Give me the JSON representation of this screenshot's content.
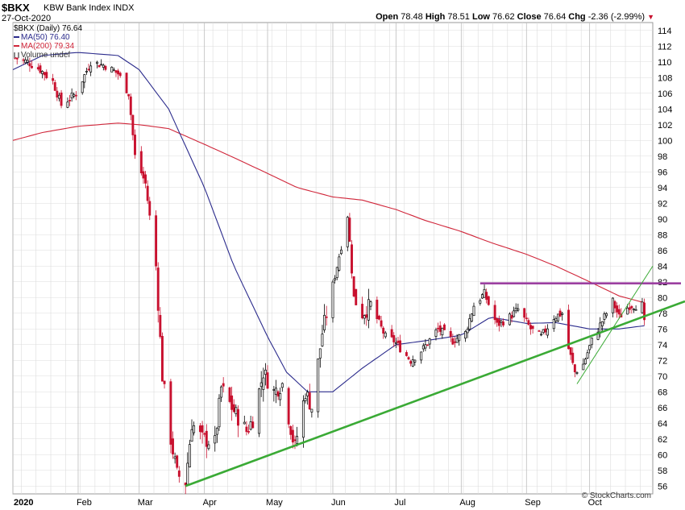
{
  "header": {
    "ticker": "$BKX",
    "name": "KBW Bank Index",
    "exchange": "INDX",
    "date": "27-Oct-2020",
    "open_label": "Open",
    "open": "78.48",
    "high_label": "High",
    "high": "78.51",
    "low_label": "Low",
    "low": "76.62",
    "close_label": "Close",
    "close": "76.64",
    "chg_label": "Chg",
    "chg": "-2.36 (-2.99%)"
  },
  "legend": {
    "price": "$BKX (Daily) 76.64",
    "ma50": "MA(50) 76.40",
    "ma200": "MA(200) 79.34",
    "volume": "Volume undef"
  },
  "credit": "© StockCharts.com",
  "colors": {
    "up": "#000000",
    "down": "#c8102e",
    "ma50": "#2b2b8c",
    "ma200": "#d0263a",
    "trend": "#3aaa35",
    "resistance": "#9b3fa0",
    "grid": "#dcdcdc"
  },
  "chart_data": {
    "type": "candlestick",
    "x_range": [
      "2020-01-01",
      "2020-10-31"
    ],
    "ylim": [
      55,
      115
    ],
    "y_ticks": [
      56,
      58,
      60,
      62,
      64,
      66,
      68,
      70,
      72,
      74,
      76,
      78,
      80,
      82,
      84,
      86,
      88,
      90,
      92,
      94,
      96,
      98,
      100,
      102,
      104,
      106,
      108,
      110,
      112,
      114
    ],
    "x_ticks": [
      {
        "label": "2020",
        "date": "2020-01-01"
      },
      {
        "label": "Feb",
        "date": "2020-02-01"
      },
      {
        "label": "Mar",
        "date": "2020-03-01"
      },
      {
        "label": "Apr",
        "date": "2020-04-01"
      },
      {
        "label": "May",
        "date": "2020-05-01"
      },
      {
        "label": "Jun",
        "date": "2020-06-01"
      },
      {
        "label": "Jul",
        "date": "2020-07-01"
      },
      {
        "label": "Aug",
        "date": "2020-08-01"
      },
      {
        "label": "Sep",
        "date": "2020-09-01"
      },
      {
        "label": "Oct",
        "date": "2020-10-01"
      }
    ],
    "close_waypoints": [
      [
        "2020-01-02",
        110.5
      ],
      [
        "2020-01-08",
        110.0
      ],
      [
        "2020-01-14",
        109.0
      ],
      [
        "2020-01-20",
        107.5
      ],
      [
        "2020-01-24",
        104.5
      ],
      [
        "2020-01-31",
        106.0
      ],
      [
        "2020-02-07",
        110.0
      ],
      [
        "2020-02-14",
        109.5
      ],
      [
        "2020-02-20",
        108.5
      ],
      [
        "2020-02-25",
        106.0
      ],
      [
        "2020-02-28",
        98.0
      ],
      [
        "2020-03-04",
        94.5
      ],
      [
        "2020-03-09",
        84.0
      ],
      [
        "2020-03-12",
        70.0
      ],
      [
        "2020-03-16",
        62.0
      ],
      [
        "2020-03-19",
        57.5
      ],
      [
        "2020-03-23",
        56.5
      ],
      [
        "2020-03-26",
        64.0
      ],
      [
        "2020-03-31",
        62.0
      ],
      [
        "2020-04-06",
        61.5
      ],
      [
        "2020-04-09",
        68.5
      ],
      [
        "2020-04-14",
        66.0
      ],
      [
        "2020-04-21",
        63.0
      ],
      [
        "2020-04-24",
        64.5
      ],
      [
        "2020-04-29",
        70.5
      ],
      [
        "2020-05-04",
        68.0
      ],
      [
        "2020-05-08",
        69.0
      ],
      [
        "2020-05-13",
        62.0
      ],
      [
        "2020-05-14",
        61.0
      ],
      [
        "2020-05-19",
        68.0
      ],
      [
        "2020-05-22",
        66.0
      ],
      [
        "2020-05-27",
        75.5
      ],
      [
        "2020-06-03",
        84.0
      ],
      [
        "2020-06-08",
        90.5
      ],
      [
        "2020-06-11",
        80.0
      ],
      [
        "2020-06-15",
        78.0
      ],
      [
        "2020-06-19",
        79.0
      ],
      [
        "2020-06-26",
        75.0
      ],
      [
        "2020-06-30",
        74.5
      ],
      [
        "2020-07-08",
        72.0
      ],
      [
        "2020-07-14",
        73.5
      ],
      [
        "2020-07-21",
        76.0
      ],
      [
        "2020-07-28",
        74.5
      ],
      [
        "2020-08-03",
        75.5
      ],
      [
        "2020-08-07",
        79.0
      ],
      [
        "2020-08-12",
        80.5
      ],
      [
        "2020-08-18",
        76.5
      ],
      [
        "2020-08-24",
        77.5
      ],
      [
        "2020-08-28",
        78.5
      ],
      [
        "2020-09-03",
        76.0
      ],
      [
        "2020-09-08",
        75.0
      ],
      [
        "2020-09-14",
        77.5
      ],
      [
        "2020-09-18",
        78.0
      ],
      [
        "2020-09-21",
        73.5
      ],
      [
        "2020-09-24",
        70.5
      ],
      [
        "2020-09-28",
        71.5
      ],
      [
        "2020-10-02",
        74.5
      ],
      [
        "2020-10-07",
        77.0
      ],
      [
        "2020-10-12",
        79.5
      ],
      [
        "2020-10-15",
        77.5
      ],
      [
        "2020-10-20",
        79.0
      ],
      [
        "2020-10-23",
        79.0
      ],
      [
        "2020-10-26",
        79.0
      ],
      [
        "2020-10-27",
        76.64
      ]
    ],
    "ma50_waypoints": [
      [
        "2020-01-01",
        109.0
      ],
      [
        "2020-01-15",
        110.8
      ],
      [
        "2020-02-01",
        111.2
      ],
      [
        "2020-02-20",
        110.8
      ],
      [
        "2020-03-01",
        109.0
      ],
      [
        "2020-03-15",
        104.0
      ],
      [
        "2020-04-01",
        94.0
      ],
      [
        "2020-04-15",
        84.0
      ],
      [
        "2020-05-01",
        75.0
      ],
      [
        "2020-05-10",
        70.5
      ],
      [
        "2020-05-20",
        68.0
      ],
      [
        "2020-06-01",
        68.0
      ],
      [
        "2020-06-15",
        71.0
      ],
      [
        "2020-07-01",
        74.0
      ],
      [
        "2020-07-15",
        74.5
      ],
      [
        "2020-08-01",
        75.2
      ],
      [
        "2020-08-15",
        77.5
      ],
      [
        "2020-09-01",
        76.7
      ],
      [
        "2020-09-15",
        76.8
      ],
      [
        "2020-10-01",
        76.0
      ],
      [
        "2020-10-15",
        76.0
      ],
      [
        "2020-10-27",
        76.4
      ]
    ],
    "ma200_waypoints": [
      [
        "2020-01-01",
        100.0
      ],
      [
        "2020-01-15",
        101.0
      ],
      [
        "2020-02-01",
        101.8
      ],
      [
        "2020-02-20",
        102.2
      ],
      [
        "2020-03-01",
        102.0
      ],
      [
        "2020-03-15",
        101.5
      ],
      [
        "2020-04-01",
        99.5
      ],
      [
        "2020-04-15",
        97.8
      ],
      [
        "2020-05-01",
        95.8
      ],
      [
        "2020-05-15",
        94.0
      ],
      [
        "2020-06-01",
        92.8
      ],
      [
        "2020-06-15",
        92.4
      ],
      [
        "2020-07-01",
        91.2
      ],
      [
        "2020-07-15",
        89.8
      ],
      [
        "2020-08-01",
        88.4
      ],
      [
        "2020-08-15",
        87.0
      ],
      [
        "2020-09-01",
        85.5
      ],
      [
        "2020-09-15",
        84.0
      ],
      [
        "2020-10-01",
        82.0
      ],
      [
        "2020-10-15",
        80.2
      ],
      [
        "2020-10-27",
        79.34
      ]
    ],
    "annotations": {
      "support_trendline": [
        [
          "2020-03-23",
          56.0
        ],
        [
          "2020-10-31",
          78.0
        ]
      ],
      "resistance_line": [
        [
          "2020-08-10",
          81.8
        ],
        [
          "2020-10-31",
          81.8
        ]
      ],
      "short_trendline": [
        [
          "2020-09-25",
          69.0
        ],
        [
          "2020-10-31",
          84.0
        ]
      ]
    }
  }
}
